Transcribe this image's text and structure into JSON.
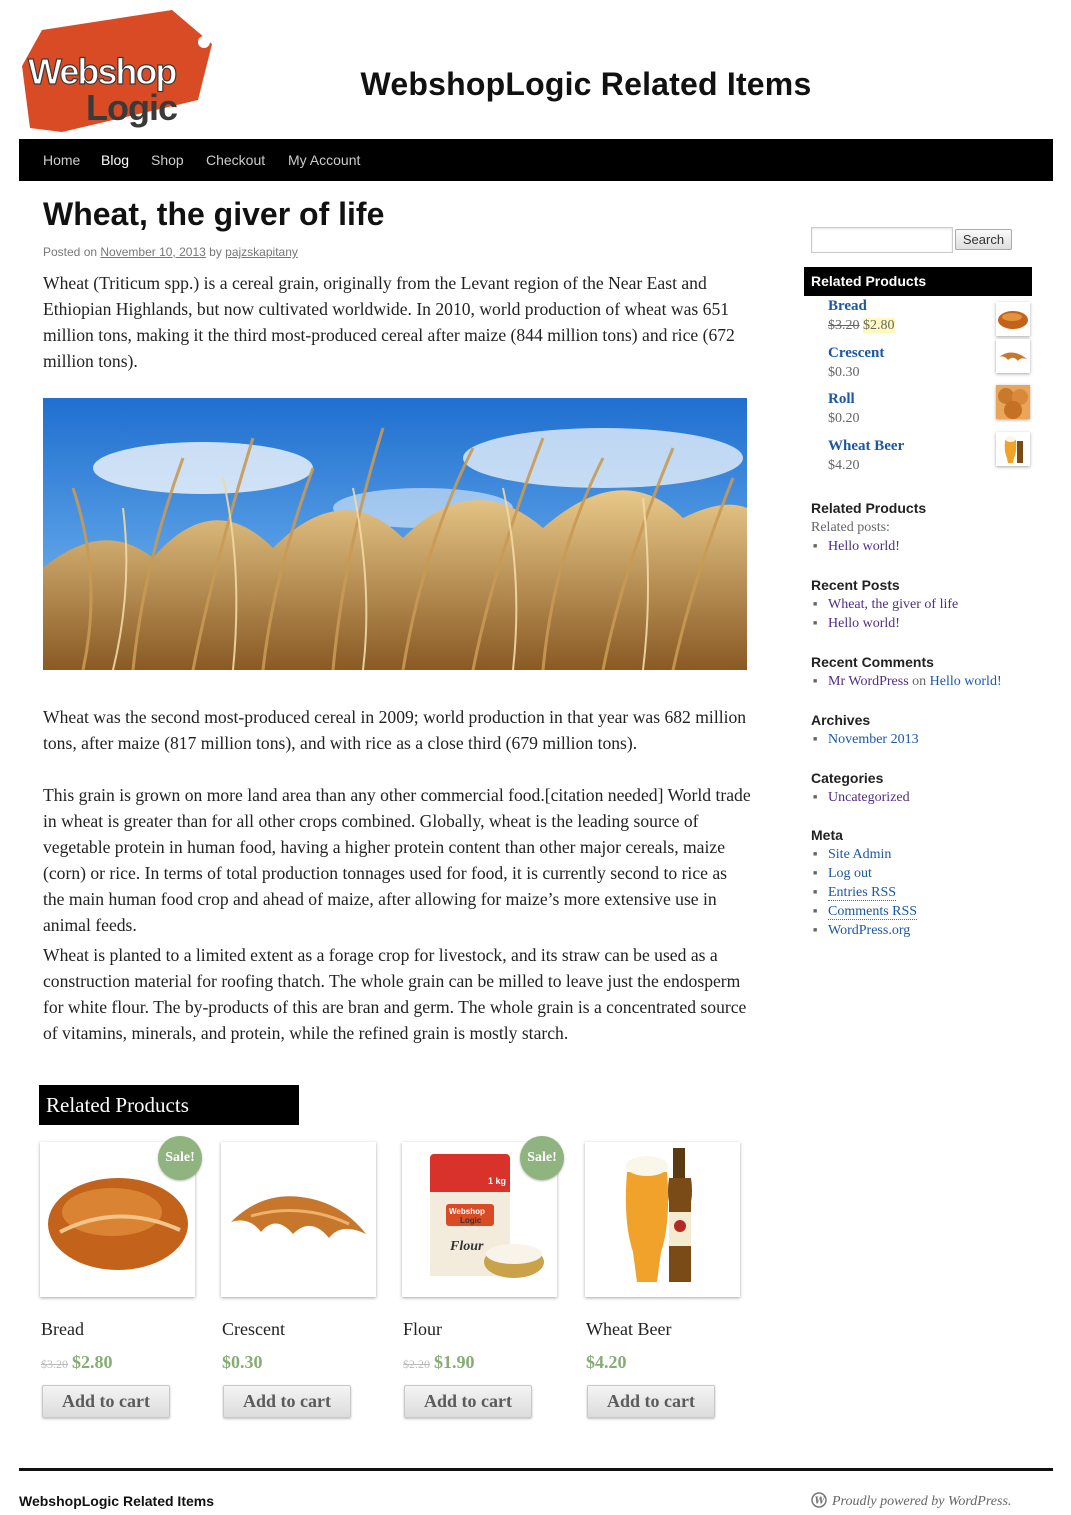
{
  "site": {
    "logo_line1": "Webshop",
    "logo_line2": "Logic",
    "title": "WebshopLogic Related Items",
    "brand_color": "#d94b25"
  },
  "nav": {
    "items": [
      {
        "label": "Home"
      },
      {
        "label": "Blog",
        "active": true
      },
      {
        "label": "Shop"
      },
      {
        "label": "Checkout"
      },
      {
        "label": "My Account"
      }
    ]
  },
  "post": {
    "title": "Wheat, the giver of life",
    "posted_on": "Posted on",
    "date": "November 10, 2013",
    "by": "by",
    "author": "pajzskapitany",
    "para1": "Wheat (Triticum spp.) is a cereal grain, originally from the Levant region of the Near East and Ethiopian Highlands, but now cultivated worldwide. In 2010, world production of wheat was 651 million tons, making it the third most-produced cereal after maize (844 million tons) and rice (672 million tons).",
    "para2": "Wheat was the second most-produced cereal in 2009; world production in that year was 682 million tons, after maize (817 million tons), and with rice as a close third (679 million tons).",
    "para3": "This grain is grown on more land area than any other commercial food.[citation needed] World trade in wheat is greater than for all other crops combined. Globally, wheat is the leading source of vegetable protein in human food, having a higher protein content than other major cereals, maize (corn) or rice. In terms of total production tonnages used for food, it is currently second to rice as the main human food crop and ahead of maize, after allowing for maize’s more extensive use in animal feeds.",
    "para4": "Wheat is planted to a limited extent as a forage crop for livestock, and its straw can be used as a construction material for roofing thatch. The whole grain can be milled to leave just the endosperm for white flour. The by-products of this are bran and germ. The whole grain is a concentrated source of vitamins, minerals, and protein, while the refined grain is mostly starch."
  },
  "related": {
    "heading": "Related Products",
    "sale_label": "Sale!",
    "add_to_cart": "Add to cart",
    "products": [
      {
        "name": "Bread",
        "old_price": "$3.20",
        "price": "$2.80",
        "sale": true
      },
      {
        "name": "Crescent",
        "old_price": "",
        "price": "$0.30",
        "sale": false
      },
      {
        "name": "Flour",
        "old_price": "$2.20",
        "price": "$1.90",
        "sale": true,
        "pack_text": "1 kg",
        "pack_brand1": "Webshop",
        "pack_brand2": "Logic",
        "pack_name": "Flour"
      },
      {
        "name": "Wheat Beer",
        "old_price": "",
        "price": "$4.20",
        "sale": false
      }
    ]
  },
  "sidebar": {
    "search_button": "Search",
    "search_value": "",
    "related_widget": {
      "title": "Related Products",
      "items": [
        {
          "name": "Bread",
          "old_price": "$3.20",
          "price": "$2.80"
        },
        {
          "name": "Crescent",
          "price": "$0.30"
        },
        {
          "name": "Roll",
          "price": "$0.20"
        },
        {
          "name": "Wheat Beer",
          "price": "$4.20"
        }
      ]
    },
    "related_posts": {
      "title": "Related Products",
      "label": "Related posts:",
      "items": [
        "Hello world!"
      ]
    },
    "recent_posts": {
      "title": "Recent Posts",
      "items": [
        "Wheat, the giver of life",
        "Hello world!"
      ]
    },
    "recent_comments": {
      "title": "Recent Comments",
      "author": "Mr WordPress",
      "on": "on",
      "post": "Hello world!"
    },
    "archives": {
      "title": "Archives",
      "items": [
        "November 2013"
      ]
    },
    "categories": {
      "title": "Categories",
      "items": [
        "Uncategorized"
      ]
    },
    "meta": {
      "title": "Meta",
      "items": [
        "Site Admin",
        "Log out",
        "Entries RSS",
        "Comments RSS",
        "WordPress.org"
      ]
    }
  },
  "footer": {
    "title": "WebshopLogic Related Items",
    "powered": "Proudly powered by WordPress."
  }
}
